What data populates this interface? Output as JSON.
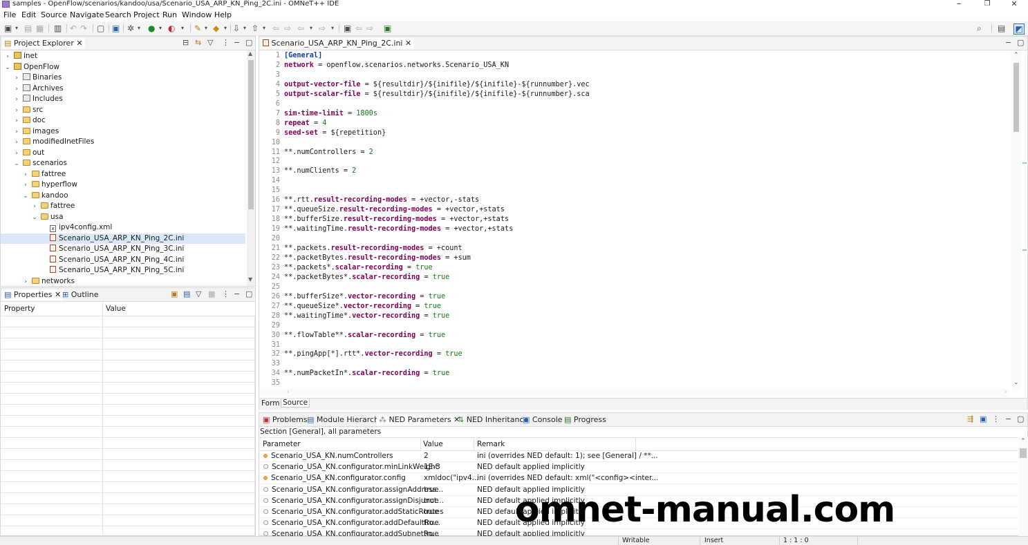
{
  "window": {
    "title": "samples - OpenFlow/scenarios/kandoo/usa/Scenario_USA_ARP_KN_Ping_2C.ini - OMNeT++ IDE",
    "minimize": "–",
    "restore": "❐",
    "close": "✕"
  },
  "menubar": [
    "File",
    "Edit",
    "Source",
    "Navigate",
    "Search",
    "Project",
    "Run",
    "Window",
    "Help"
  ],
  "project_explorer": {
    "tab_label": "Project Explorer",
    "items": [
      {
        "label": "inet",
        "depth": 0,
        "twisty": "›",
        "icon": "project"
      },
      {
        "label": "OpenFlow",
        "depth": 0,
        "twisty": "⌄",
        "icon": "project"
      },
      {
        "label": "Binaries",
        "depth": 1,
        "twisty": "›",
        "icon": "gear"
      },
      {
        "label": "Archives",
        "depth": 1,
        "twisty": "›",
        "icon": "grid"
      },
      {
        "label": "Includes",
        "depth": 1,
        "twisty": "›",
        "icon": "grid"
      },
      {
        "label": "src",
        "depth": 1,
        "twisty": "›",
        "icon": "folder"
      },
      {
        "label": "doc",
        "depth": 1,
        "twisty": "›",
        "icon": "folder"
      },
      {
        "label": "images",
        "depth": 1,
        "twisty": "›",
        "icon": "folder"
      },
      {
        "label": "modifiedInetFiles",
        "depth": 1,
        "twisty": "›",
        "icon": "folder"
      },
      {
        "label": "out",
        "depth": 1,
        "twisty": "›",
        "icon": "folder"
      },
      {
        "label": "scenarios",
        "depth": 1,
        "twisty": "⌄",
        "icon": "folder"
      },
      {
        "label": "fattree",
        "depth": 2,
        "twisty": "›",
        "icon": "folder"
      },
      {
        "label": "hyperflow",
        "depth": 2,
        "twisty": "›",
        "icon": "folder"
      },
      {
        "label": "kandoo",
        "depth": 2,
        "twisty": "⌄",
        "icon": "folder"
      },
      {
        "label": "fattree",
        "depth": 3,
        "twisty": "›",
        "icon": "folder"
      },
      {
        "label": "usa",
        "depth": 3,
        "twisty": "⌄",
        "icon": "folder"
      },
      {
        "label": "ipv4config.xml",
        "depth": 4,
        "twisty": "",
        "icon": "xml"
      },
      {
        "label": "Scenario_USA_ARP_KN_Ping_2C.ini",
        "depth": 4,
        "twisty": "",
        "icon": "ini",
        "selected": true
      },
      {
        "label": "Scenario_USA_ARP_KN_Ping_3C.ini",
        "depth": 4,
        "twisty": "",
        "icon": "ini"
      },
      {
        "label": "Scenario_USA_ARP_KN_Ping_4C.ini",
        "depth": 4,
        "twisty": "",
        "icon": "ini"
      },
      {
        "label": "Scenario_USA_ARP_KN_Ping_5C.ini",
        "depth": 4,
        "twisty": "",
        "icon": "ini"
      },
      {
        "label": "networks",
        "depth": 2,
        "twisty": "›",
        "icon": "folder"
      }
    ]
  },
  "properties": {
    "tab_label": "Properties",
    "outline_label": "Outline",
    "col_property": "Property",
    "col_value": "Value"
  },
  "editor": {
    "tab_label": "Scenario_USA_ARP_KN_Ping_2C.ini",
    "lines": [
      [
        [
          "sec",
          "[General]"
        ]
      ],
      [
        [
          "k",
          "network"
        ],
        [
          "t",
          " = openflow.scenarios.networks.Scenario_USA_KN"
        ]
      ],
      [],
      [
        [
          "k",
          "output-vector-file"
        ],
        [
          "t",
          " = ${resultdir}/${inifile}/${inifile}-${runnumber}.vec"
        ]
      ],
      [
        [
          "k",
          "output-scalar-file"
        ],
        [
          "t",
          " = ${resultdir}/${inifile}/${inifile}-${runnumber}.sca"
        ]
      ],
      [],
      [
        [
          "k",
          "sim-time-limit"
        ],
        [
          "t",
          " = "
        ],
        [
          "num",
          "1800s"
        ]
      ],
      [
        [
          "k",
          "repeat"
        ],
        [
          "t",
          " = "
        ],
        [
          "num",
          "4"
        ]
      ],
      [
        [
          "k",
          "seed-set"
        ],
        [
          "t",
          " = ${repetition}"
        ]
      ],
      [],
      [
        [
          "t",
          "**.numControllers = "
        ],
        [
          "num",
          "2"
        ]
      ],
      [],
      [
        [
          "t",
          "**.numClients = "
        ],
        [
          "num",
          "2"
        ]
      ],
      [],
      [],
      [
        [
          "t",
          "**.rtt."
        ],
        [
          "k",
          "result-recording-modes"
        ],
        [
          "t",
          " = +vector,-stats"
        ]
      ],
      [
        [
          "t",
          "**.queueSize."
        ],
        [
          "k",
          "result-recording-modes"
        ],
        [
          "t",
          " = +vector,+stats"
        ]
      ],
      [
        [
          "t",
          "**.bufferSize."
        ],
        [
          "k",
          "result-recording-modes"
        ],
        [
          "t",
          " = +vector,+stats"
        ]
      ],
      [
        [
          "t",
          "**.waitingTime."
        ],
        [
          "k",
          "result-recording-modes"
        ],
        [
          "t",
          " = +vector,+stats"
        ]
      ],
      [],
      [
        [
          "t",
          "**.packets."
        ],
        [
          "k",
          "result-recording-modes"
        ],
        [
          "t",
          " = +count"
        ]
      ],
      [
        [
          "t",
          "**.packetBytes."
        ],
        [
          "k",
          "result-recording-modes"
        ],
        [
          "t",
          " = +sum"
        ]
      ],
      [
        [
          "t",
          "**.packets*."
        ],
        [
          "k",
          "scalar-recording"
        ],
        [
          "t",
          " = "
        ],
        [
          "bool",
          "true"
        ]
      ],
      [
        [
          "t",
          "**.packetBytes*."
        ],
        [
          "k",
          "scalar-recording"
        ],
        [
          "t",
          " = "
        ],
        [
          "bool",
          "true"
        ]
      ],
      [],
      [
        [
          "t",
          "**.bufferSize*."
        ],
        [
          "k",
          "vector-recording"
        ],
        [
          "t",
          " = "
        ],
        [
          "bool",
          "true"
        ]
      ],
      [
        [
          "t",
          "**.queueSize*."
        ],
        [
          "k",
          "vector-recording"
        ],
        [
          "t",
          " = "
        ],
        [
          "bool",
          "true"
        ]
      ],
      [
        [
          "t",
          "**.waitingTime*."
        ],
        [
          "k",
          "vector-recording"
        ],
        [
          "t",
          " = "
        ],
        [
          "bool",
          "true"
        ]
      ],
      [],
      [
        [
          "t",
          "**.flowTable**."
        ],
        [
          "k",
          "scalar-recording"
        ],
        [
          "t",
          " = "
        ],
        [
          "bool",
          "true"
        ]
      ],
      [],
      [
        [
          "t",
          "**.pingApp[*].rtt*."
        ],
        [
          "k",
          "vector-recording"
        ],
        [
          "t",
          " = "
        ],
        [
          "bool",
          "true"
        ]
      ],
      [],
      [
        [
          "t",
          "**.numPacketIn*."
        ],
        [
          "k",
          "scalar-recording"
        ],
        [
          "t",
          " = "
        ],
        [
          "bool",
          "true"
        ]
      ],
      []
    ],
    "bottom_tabs": [
      "Form",
      "Source"
    ]
  },
  "bottom_panel": {
    "tabs": [
      "Problems",
      "Module Hierarchy",
      "NED Parameters",
      "NED Inheritance",
      "Console",
      "Progress"
    ],
    "section_label": "Section [General], all parameters",
    "columns": [
      "Parameter",
      "Value",
      "Remark"
    ],
    "rows": [
      {
        "param": "Scenario_USA_KN.numControllers",
        "value": "2",
        "remark": "ini (overrides NED default: 1); see [General] / **...",
        "kind": "f"
      },
      {
        "param": "Scenario_USA_KN.configurator.minLinkWeight",
        "value": "1E-3",
        "remark": "NED default applied implicitly",
        "kind": "o"
      },
      {
        "param": "Scenario_USA_KN.configurator.config",
        "value": "xmldoc(\"ipv4...",
        "remark": "ini (overrides NED default: xml(\"<config><inter...",
        "kind": "f"
      },
      {
        "param": "Scenario_USA_KN.configurator.assignAddress...",
        "value": "true",
        "remark": "NED default applied implicitly",
        "kind": "o"
      },
      {
        "param": "Scenario_USA_KN.configurator.assignDisjunct...",
        "value": "true",
        "remark": "NED default applied implicitly",
        "kind": "o"
      },
      {
        "param": "Scenario_USA_KN.configurator.addStaticRoutes",
        "value": "true",
        "remark": "NED default applied implicitly",
        "kind": "o"
      },
      {
        "param": "Scenario_USA_KN.configurator.addDefaultRo...",
        "value": "true",
        "remark": "NED default applied implicitly",
        "kind": "o"
      },
      {
        "param": "Scenario_USA_KN.configurator.addSubnetRo...",
        "value": "true",
        "remark": "NED default applied implicitly",
        "kind": "o"
      }
    ]
  },
  "statusbar": {
    "writable": "Writable",
    "insert": "Insert",
    "position": "1 : 1 : 0"
  },
  "watermark": "omnet-manual.com"
}
